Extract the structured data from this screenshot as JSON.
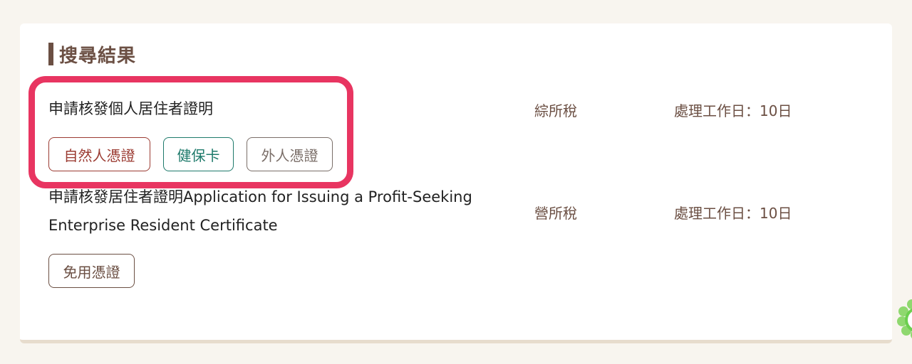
{
  "section": {
    "title": "搜尋結果"
  },
  "results": [
    {
      "title": "申請核發個人居住者證明",
      "category": "綜所稅",
      "processing_days": "處理工作日：10日",
      "tags": [
        "自然人憑證",
        "健保卡",
        "外人憑證"
      ]
    },
    {
      "title_line1": "申請核發居住者證明Application for Issuing a Profit-Seeking",
      "title_line2": "Enterprise Resident Certificate",
      "category": "營所稅",
      "processing_days": "處理工作日：10日",
      "tags": [
        "免用憑證"
      ]
    }
  ],
  "colors": {
    "accent_brown": "#6b4f43",
    "tag_red": "#9b3b32",
    "tag_green": "#1e7a6b",
    "tag_gray": "#7a6e68",
    "highlight_pink": "#e83561",
    "page_background": "#f8f5ef"
  },
  "icons": {
    "corner_decoration": "flower-icon"
  }
}
